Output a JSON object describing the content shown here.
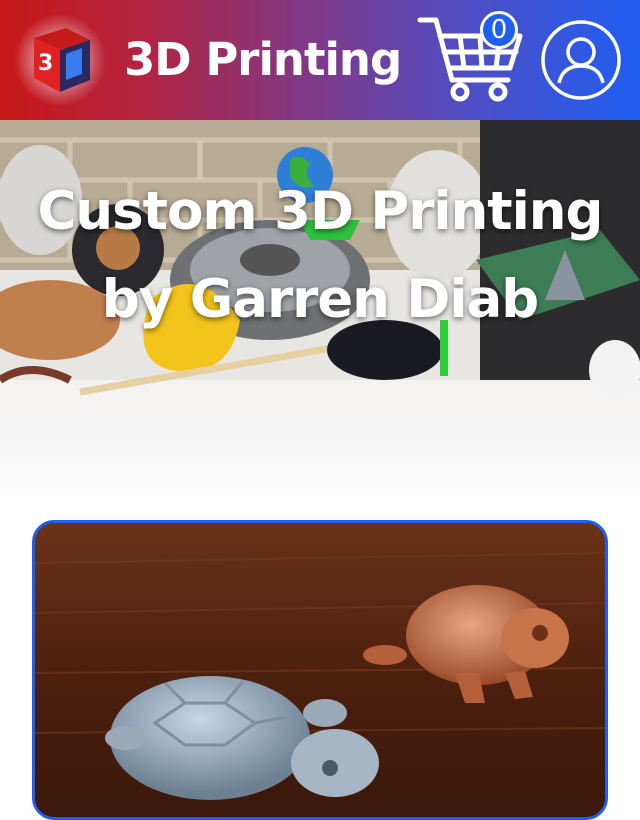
{
  "header": {
    "brand": "3D Printing",
    "logo_text": "3D",
    "cart_count": "0",
    "cart_icon": "shopping-cart-icon",
    "account_icon": "user-account-icon",
    "gradient": [
      "#c81818",
      "#1f5ef2"
    ]
  },
  "hero": {
    "title_line1": "Custom 3D Printing",
    "title_line2": "by Garren Diab"
  },
  "card": {
    "image": "turtle-prints-photo",
    "border_color": "#1f5ef2"
  }
}
